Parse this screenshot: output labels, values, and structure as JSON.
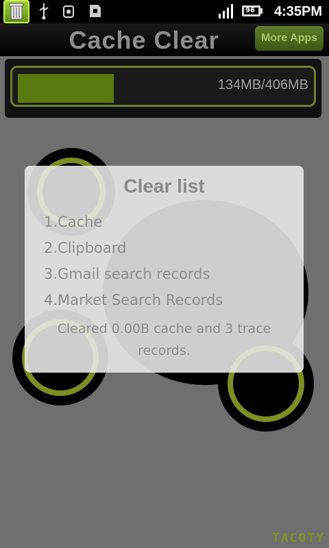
{
  "status_bar": {
    "time": "4:35PM",
    "battery_level": "96",
    "icons": [
      "trash-app-icon",
      "usb-icon",
      "usb-debug-icon",
      "sd-card-icon",
      "signal-icon",
      "battery-icon"
    ]
  },
  "header": {
    "title": "Cache Clear",
    "more_apps_label": "More Apps"
  },
  "storage": {
    "used_label": "134MB/406MB",
    "used_fraction": 0.33
  },
  "dialog": {
    "title": "Clear list",
    "items": [
      "1.Cache",
      "2.Clipboard",
      "3.Gmail search records",
      "4.Market Search Records"
    ],
    "message": "Cleared 0.00B cache and 3 trace records."
  },
  "brand": "TACOTY",
  "colors": {
    "accent_green": "#7b8f22",
    "fill_green": "#5a7a0f"
  }
}
